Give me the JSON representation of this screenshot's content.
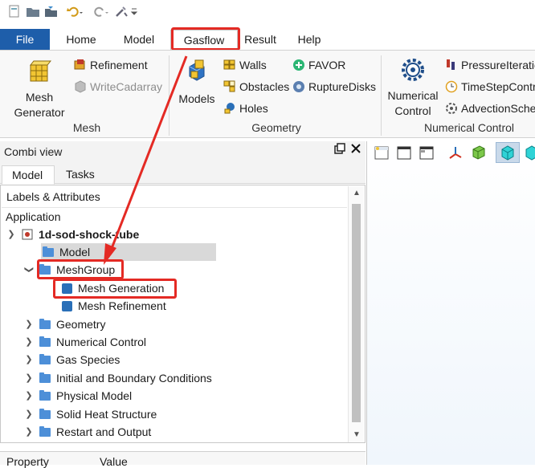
{
  "qat": {
    "icons": [
      "app-icon",
      "open-folder-icon",
      "save-icon",
      "undo-icon",
      "redo-icon",
      "tools-icon",
      "dropdown-icon"
    ]
  },
  "ribbon_tabs": [
    "File",
    "Home",
    "Model",
    "Gasflow",
    "Result",
    "Help"
  ],
  "ribbon": {
    "mesh_group": {
      "label": "Mesh",
      "mesh_generator": "Mesh\nGenerator",
      "refinement": "Refinement",
      "write_cadarray": "WriteCadarray"
    },
    "geometry_group": {
      "label": "Geometry",
      "models": "Models",
      "walls": "Walls",
      "obstacles": "Obstacles",
      "holes": "Holes",
      "favor": "FAVOR",
      "rupture_disks": "RuptureDisks"
    },
    "numerical_group": {
      "label": "Numerical Control",
      "numerical_control": "Numerical\nControl",
      "pressure_iteration": "PressureIteratio",
      "timestep_control": "TimeStepContro",
      "advection_scheme": "AdvectionScher"
    }
  },
  "combi": {
    "title": "Combi view",
    "tabs": [
      "Model",
      "Tasks"
    ],
    "header": "Labels & Attributes",
    "section": "Application",
    "root": "1d-sod-shock-tube",
    "items": [
      {
        "label": "Model",
        "level": 1,
        "expandable": false,
        "icon": "folder"
      },
      {
        "label": "MeshGroup",
        "level": 1,
        "expandable": true,
        "expanded": true,
        "icon": "folder"
      },
      {
        "label": "Mesh Generation",
        "level": 2,
        "expandable": false,
        "icon": "cube"
      },
      {
        "label": "Mesh Refinement",
        "level": 2,
        "expandable": false,
        "icon": "cube"
      },
      {
        "label": "Geometry",
        "level": 1,
        "expandable": true,
        "icon": "folder"
      },
      {
        "label": "Numerical Control",
        "level": 1,
        "expandable": true,
        "icon": "folder"
      },
      {
        "label": "Gas Species",
        "level": 1,
        "expandable": true,
        "icon": "folder"
      },
      {
        "label": "Initial and Boundary Conditions",
        "level": 1,
        "expandable": true,
        "icon": "folder"
      },
      {
        "label": "Physical Model",
        "level": 1,
        "expandable": true,
        "icon": "folder"
      },
      {
        "label": "Solid Heat Structure",
        "level": 1,
        "expandable": true,
        "icon": "folder"
      },
      {
        "label": "Restart and Output",
        "level": 1,
        "expandable": true,
        "icon": "folder"
      }
    ],
    "property_header": {
      "property": "Property",
      "value": "Value"
    }
  },
  "colors": {
    "accent": "#1e5eaa",
    "annotation": "#e42a24",
    "folder": "#4d8fd8",
    "cube": "#2a6fb8",
    "selection": "#d9d9d9"
  }
}
